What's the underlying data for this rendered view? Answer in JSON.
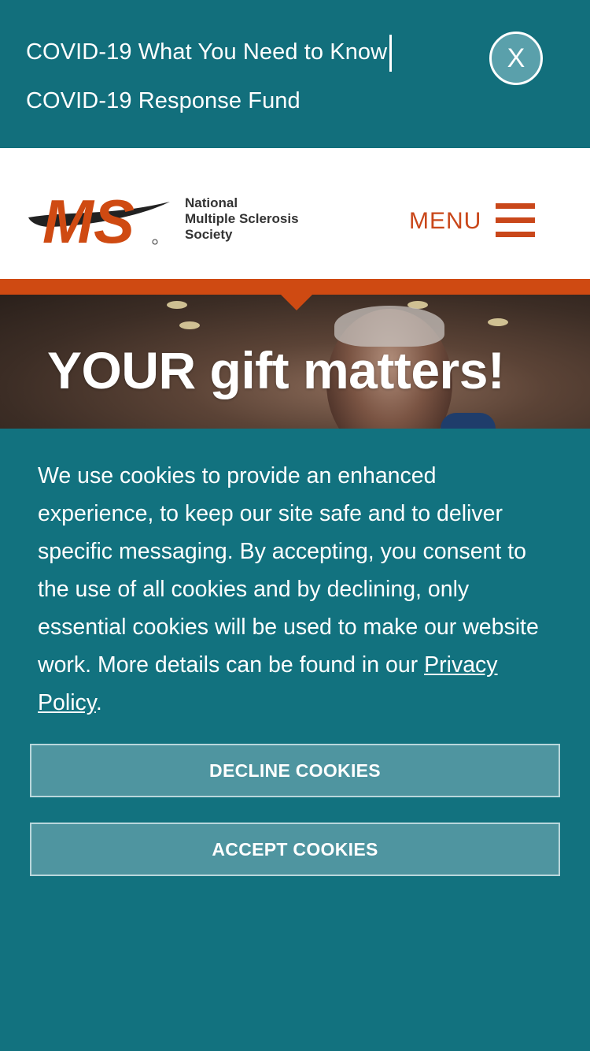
{
  "alert_bar": {
    "link1": "COVID-19 What You Need to Know",
    "link2": "COVID-19 Response Fund",
    "close_label": "X"
  },
  "header": {
    "logo_mark": "MS",
    "logo_lines": [
      "National",
      "Multiple Sclerosis",
      "Society"
    ],
    "menu_label": "MENU"
  },
  "hero": {
    "title": "YOUR gift matters!"
  },
  "cookie_banner": {
    "text": "We use cookies to provide an enhanced experience, to keep our site safe and to deliver specific messaging. By accepting, you consent to the use of all cookies and by declining, only essential cookies will be used to make our website work. More details can be found in our ",
    "privacy_link": "Privacy Policy",
    "text_end": ".",
    "decline_label": "DECLINE COOKIES",
    "accept_label": "ACCEPT COOKIES"
  },
  "colors": {
    "teal": "#12727f",
    "brand_orange": "#cf4a12",
    "button_bg": "#4f95a0"
  },
  "icons": [
    "close-icon",
    "hamburger-menu-icon"
  ]
}
